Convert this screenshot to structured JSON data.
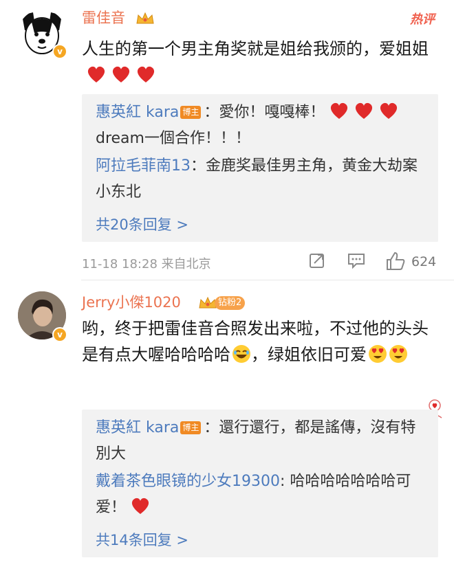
{
  "comments": [
    {
      "username": "雷佳音",
      "hot_label": "热评",
      "text": "人生的第一个男主角奖就是姐给我颁的，爱姐姐",
      "replies": [
        {
          "name": "惠英紅 kara",
          "tag": "博主",
          "text": "：愛你！嘎嘎棒！",
          "extra": "dream一個合作！！！"
        },
        {
          "name": "阿拉毛菲南13",
          "tag": "",
          "text": "：金鹿奖最佳男主角，黄金大劫案 小东北",
          "extra": ""
        }
      ],
      "more_replies": "共20条回复 >",
      "meta": "11-18 18:28 来自北京",
      "like_count": "624"
    },
    {
      "username": "Jerry小傑1020",
      "fan_badge": "钻粉2",
      "text_a": "哟，终于把雷佳音合照发出来啦，不过他的头头是有点大喔哈哈哈哈",
      "text_b": "，绿姐依旧可爱",
      "replies": [
        {
          "name": "惠英紅 kara",
          "tag": "博主",
          "text": "：還行還行，都是謠傳，沒有特別大",
          "extra": ""
        },
        {
          "name": "戴着茶色眼镜的少女19300",
          "tag": "",
          "text": ": 哈哈哈哈哈哈哈可爱！",
          "extra": ""
        }
      ],
      "more_replies": "共14条回复 >"
    }
  ],
  "colors": {
    "username": "#eb7350",
    "reply_name": "#4d7bbd",
    "heart": "#e02a2a",
    "badge": "#f5a623"
  },
  "icons": [
    "dog-avatar",
    "crown-icon",
    "heart-icon",
    "share-icon",
    "comment-icon",
    "like-icon",
    "laugh-emoji",
    "heart-eyes-emoji"
  ]
}
